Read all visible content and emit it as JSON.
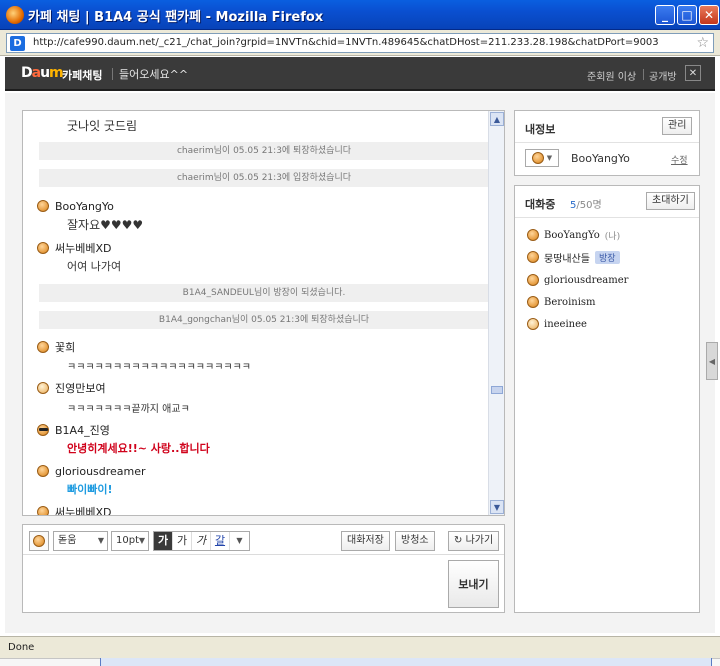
{
  "window": {
    "title": "카페 채팅 | B1A4 공식 팬카페 - Mozilla Firefox",
    "minimize_glyph": "_",
    "maximize_glyph": "□",
    "close_glyph": "✕"
  },
  "address": {
    "favicon_glyph": "D",
    "url": "http://cafe990.daum.net/_c21_/chat_join?grpid=1NVTn&chid=1NVTn.489645&chatDHost=211.233.28.198&chatDPort=9003"
  },
  "header": {
    "logo_parts": [
      "D",
      "a",
      "u",
      "m"
    ],
    "cafe_label": "카페채팅",
    "greeting": "들어오세요^^",
    "right_link1": "준회원 이상",
    "right_link2": "공개방"
  },
  "chat": {
    "first_line": "굿나잇 굿드림",
    "system_messages": [
      "chaerim님이 05.05 21:3에 퇴장하셨습니다",
      "chaerim님이 05.05 21:3에 입장하셨습니다",
      "B1A4_SANDEUL님이 방장이 되셨습니다.",
      "B1A4_gongchan님이 05.05 21:3에 퇴장하셨습니다"
    ],
    "messages": [
      {
        "nick": "BooYangYo",
        "text": "잘자요♥♥♥♥"
      },
      {
        "nick": "써누베베XD",
        "text": "어여 나가여"
      },
      {
        "nick": "꽃희",
        "text": "ㅋㅋㅋㅋㅋㅋㅋㅋㅋㅋㅋㅋㅋㅋㅋㅋㅋㅋㅋㅋ"
      },
      {
        "nick": "진영만보여",
        "text": "ㅋㅋㅋㅋㅋㅋㅋ끝까지 애교ㅋ"
      },
      {
        "nick": "B1A4_진영",
        "text": "안녕히계세요!!~ 사랑..합니다"
      },
      {
        "nick": "gloriousdreamer",
        "text": "빠이빠이!"
      },
      {
        "nick": "써누베베XD",
        "text": ""
      }
    ],
    "accent_red": "#d0021b",
    "accent_blue": "#1e9be0"
  },
  "toolbar": {
    "font": "돋움",
    "size": "10pt",
    "fmt_bold": "가",
    "fmt_normal": "가",
    "fmt_italic": "가",
    "fmt_underline": "갈",
    "save_chat": "대화저장",
    "clean_room": "방청소",
    "leave": "나가기",
    "leave_icon": "↻"
  },
  "send": {
    "label": "보내기"
  },
  "myinfo": {
    "title": "내정보",
    "manage": "관리",
    "name": "BooYangYo",
    "edit": "수정",
    "dropdown_glyph": "▼"
  },
  "members": {
    "title": "대화중",
    "count": "5",
    "total": "/50명",
    "invite": "초대하기",
    "list": [
      {
        "nick": "BooYangYo",
        "tag": "(나)"
      },
      {
        "nick": "뭉땅내산들",
        "tag": "방장"
      },
      {
        "nick": "gloriousdreamer",
        "tag": ""
      },
      {
        "nick": "Beroinism",
        "tag": ""
      },
      {
        "nick": "ineeinee",
        "tag": ""
      }
    ]
  },
  "status": {
    "text": "Done"
  }
}
